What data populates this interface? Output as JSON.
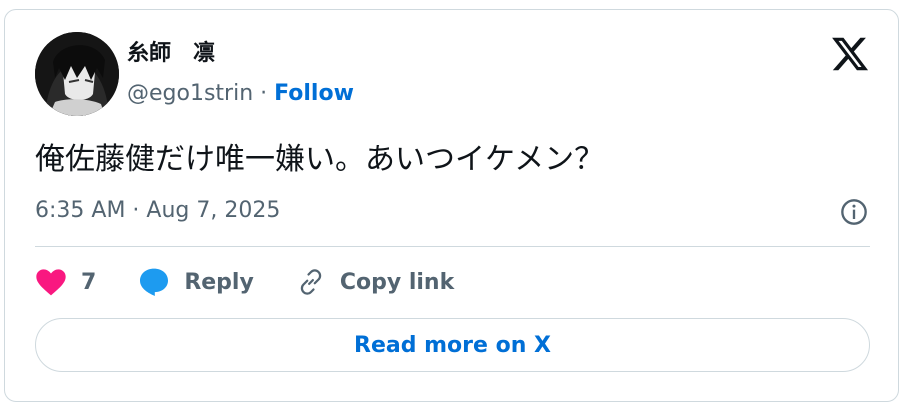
{
  "user": {
    "display_name": "糸師　凛",
    "handle": "@ego1strin",
    "separator": " · ",
    "follow_label": "Follow"
  },
  "tweet": {
    "text": "俺佐藤健だけ唯一嫌い。あいつイケメン？",
    "timestamp": "6:35 AM · Aug 7, 2025"
  },
  "actions": {
    "like_count": "7",
    "reply_label": "Reply",
    "copy_link_label": "Copy link"
  },
  "footer": {
    "read_more_label": "Read more on X"
  },
  "colors": {
    "accent": "#006fd6",
    "like": "#f91880",
    "reply_icon": "#1d9bf0",
    "muted": "#536471",
    "border": "#cfd9de"
  },
  "icons": [
    "x-logo-icon",
    "info-icon",
    "heart-icon",
    "reply-bubble-icon",
    "link-icon"
  ]
}
